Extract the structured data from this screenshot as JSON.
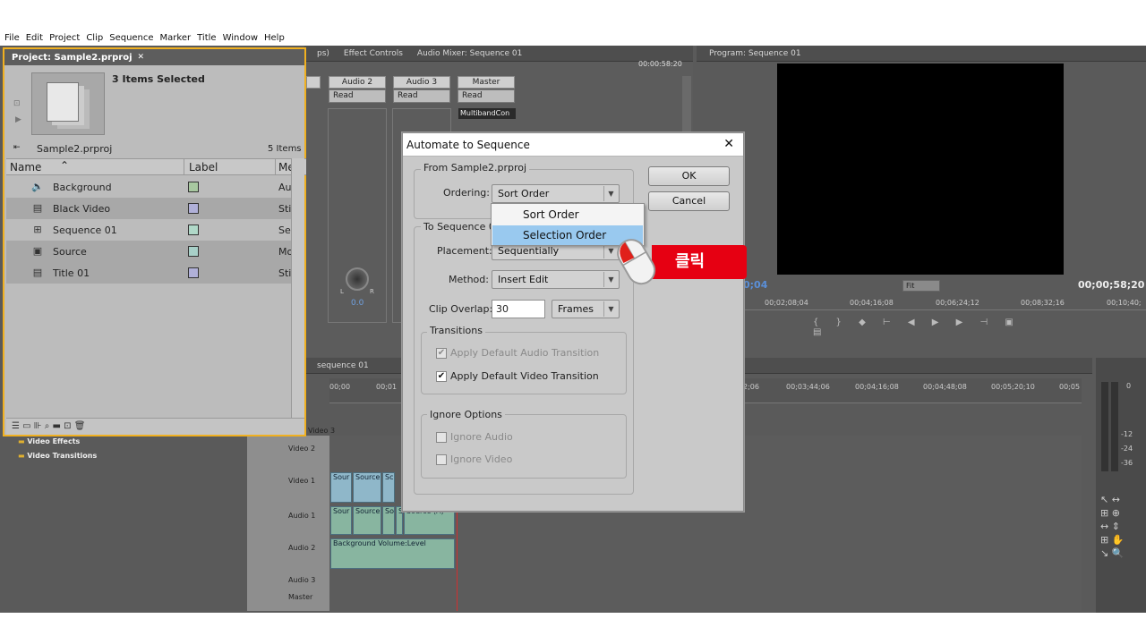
{
  "menu": [
    "File",
    "Edit",
    "Project",
    "Clip",
    "Sequence",
    "Marker",
    "Title",
    "Window",
    "Help"
  ],
  "tabs_top": {
    "partial": "ps)",
    "effect_controls": "Effect Controls",
    "audio_mixer": "Audio Mixer: Sequence 01",
    "mixer_time": "00:00:58:20",
    "program": "Program: Sequence 01"
  },
  "mixer": {
    "channels": [
      "Audio 2",
      "Audio 3",
      "Master"
    ],
    "read": [
      "Read",
      "Read",
      "Read"
    ],
    "effect_slot": "MultibandCon",
    "knob_value": "0.0",
    "knob_l": "L",
    "knob_r": "R"
  },
  "program": {
    "timecode_left": "0;04",
    "fit_label": "Fit",
    "timecode_right": "00;00;58;20",
    "ruler": [
      "00;02;08;04",
      "00;04;16;08",
      "00;06;24;12",
      "00;08;32;16",
      "00;10;40;"
    ]
  },
  "timeline": {
    "tab": "sequence 01",
    "ruler_left": [
      "00;00",
      "00;01"
    ],
    "ruler": [
      "2;06",
      "00;03;44;06",
      "00;04;16;08",
      "00;04;48;08",
      "00;05;20;10",
      "00;05"
    ],
    "tracks": [
      "Video 3",
      "Video 2",
      "Video 1",
      "Audio 1",
      "Audio 2",
      "Audio 3",
      "Master"
    ],
    "clips_v1": [
      "Sour",
      "Source",
      "Sc"
    ],
    "clips_a1": [
      "Sour",
      "Source",
      "So",
      "S",
      "Source (A)"
    ],
    "audio2_clip": "Background  Volume:Level",
    "meter_labels": [
      "0",
      "-12",
      "-24",
      "-36"
    ]
  },
  "effects": {
    "items": [
      "Video Effects",
      "Video Transitions"
    ]
  },
  "project": {
    "title": "Project: Sample2.prproj",
    "selected_info": "3 Items Selected",
    "file_name": "Sample2.prproj",
    "item_count": "5 Items",
    "columns": [
      "Name",
      "Label",
      "Me"
    ],
    "items": [
      {
        "name": "Background",
        "icon": "audio-icon",
        "label_color": "#a8c8a0",
        "media": "Au",
        "selected": false
      },
      {
        "name": "Black Video",
        "icon": "still-icon",
        "label_color": "#b0b0d8",
        "media": "Stil",
        "selected": true
      },
      {
        "name": "Sequence 01",
        "icon": "sequence-icon",
        "label_color": "#b0d8c8",
        "media": "Sec",
        "selected": false
      },
      {
        "name": "Source",
        "icon": "movie-icon",
        "label_color": "#a8d0c8",
        "media": "Mo",
        "selected": true
      },
      {
        "name": "Title 01",
        "icon": "title-icon",
        "label_color": "#b0b0d8",
        "media": "Stil",
        "selected": true
      }
    ],
    "border_color": "#f0b020"
  },
  "dialog": {
    "title": "Automate to Sequence",
    "from_group": "From Sample2.prproj",
    "ordering_label": "Ordering:",
    "ordering_value": "Sort Order",
    "ok": "OK",
    "cancel": "Cancel",
    "to_group": "To Sequence 01",
    "placement_label": "Placement:",
    "placement_value": "Sequentially",
    "method_label": "Method:",
    "method_value": "Insert Edit",
    "overlap_label": "Clip Overlap:",
    "overlap_value": "30",
    "overlap_unit": "Frames",
    "transitions_group": "Transitions",
    "apply_audio": "Apply Default Audio Transition",
    "apply_audio_checked": true,
    "apply_video": "Apply Default Video Transition",
    "apply_video_checked": true,
    "ignore_group": "Ignore Options",
    "ignore_audio": "Ignore Audio",
    "ignore_video": "Ignore Video"
  },
  "dropdown": {
    "options": [
      "Sort Order",
      "Selection Order"
    ],
    "highlighted": "Selection Order"
  },
  "annotation": {
    "text": "클릭",
    "color": "#e60012"
  }
}
